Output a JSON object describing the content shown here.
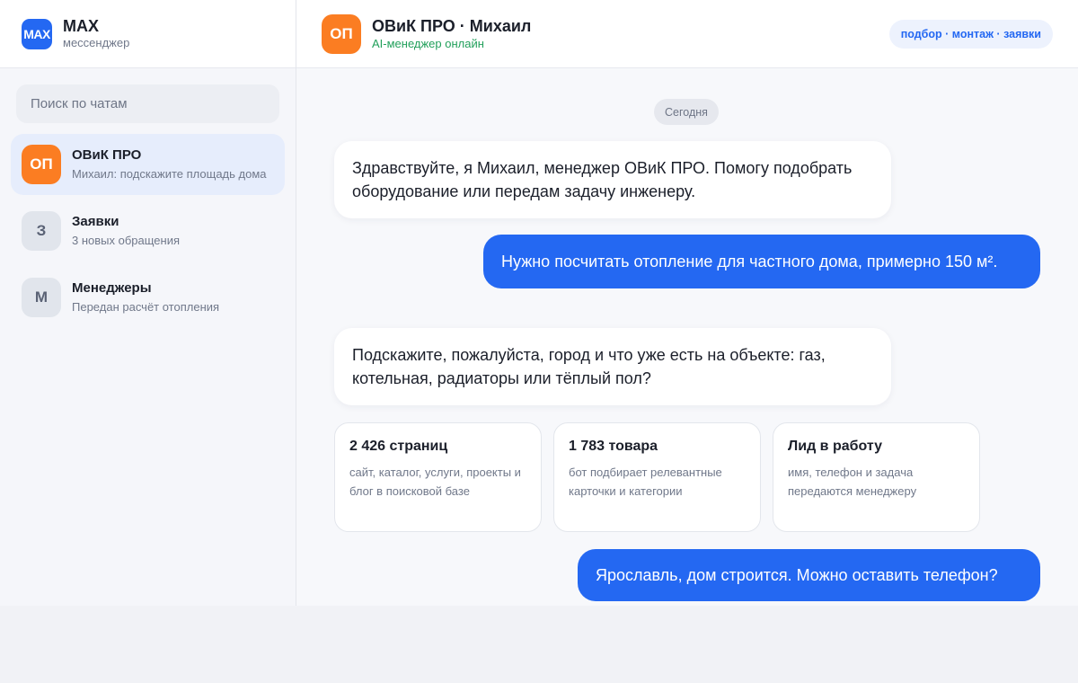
{
  "app": {
    "logo_text": "MAX",
    "name": "MAX",
    "subtitle": "мессенджер",
    "accent_color": "#2468f2"
  },
  "sidebar": {
    "search_placeholder": "Поиск по чатам",
    "chats": [
      {
        "avatar": "ОП",
        "title": "ОВиК ПРО",
        "preview": "Михаил: подскажите площадь дома",
        "active": true,
        "avatar_color": "#fb7d22"
      },
      {
        "avatar": "З",
        "title": "Заявки",
        "preview": "3 новых обращения",
        "active": false,
        "avatar_color": "#e1e5ec"
      },
      {
        "avatar": "М",
        "title": "Менеджеры",
        "preview": "Передан расчёт отопления",
        "active": false,
        "avatar_color": "#e1e5ec"
      }
    ]
  },
  "header": {
    "avatar": "ОП",
    "title": "ОВиК ПРО · Михаил",
    "status": "AI-менеджер онлайн",
    "pill": "подбор · монтаж · заявки"
  },
  "messages": {
    "date_chip": "Сегодня",
    "items": [
      {
        "direction": "in",
        "text": "Здравствуйте, я Михаил, менеджер ОВиК ПРО. Помогу подобрать оборудование или передам задачу инженеру."
      },
      {
        "direction": "out",
        "text": "Нужно посчитать отопление для частного дома, примерно 150 м²."
      },
      {
        "direction": "in",
        "text": "Подскажите, пожалуйста, город и что уже есть на объекте: газ, котельная, радиаторы или тёплый пол?"
      },
      {
        "direction": "out",
        "text": "Ярославль, дом строится. Можно оставить телефон?"
      }
    ]
  },
  "cards": [
    {
      "title": "2 426 страниц",
      "desc": "сайт, каталог, услуги, проекты и блог в поисковой базе"
    },
    {
      "title": "1 783 товара",
      "desc": "бот подбирает релевантные карточки и категории"
    },
    {
      "title": "Лид в работу",
      "desc": "имя, телефон и задача передаются менеджеру"
    }
  ]
}
